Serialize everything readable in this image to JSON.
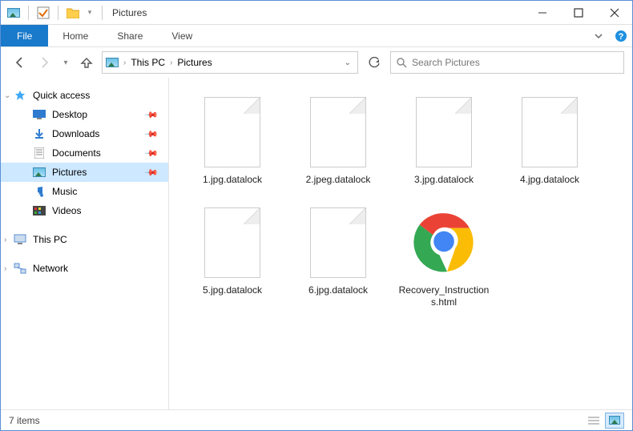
{
  "window": {
    "title": "Pictures"
  },
  "ribbon": {
    "file": "File",
    "tabs": [
      "Home",
      "Share",
      "View"
    ]
  },
  "breadcrumb": {
    "parts": [
      "This PC",
      "Pictures"
    ]
  },
  "search": {
    "placeholder": "Search Pictures"
  },
  "sidebar": {
    "quick_access": "Quick access",
    "quick_items": [
      {
        "label": "Desktop"
      },
      {
        "label": "Downloads"
      },
      {
        "label": "Documents"
      },
      {
        "label": "Pictures"
      },
      {
        "label": "Music"
      },
      {
        "label": "Videos"
      }
    ],
    "this_pc": "This PC",
    "network": "Network"
  },
  "files": [
    {
      "name": "1.jpg.datalock",
      "type": "file"
    },
    {
      "name": "2.jpeg.datalock",
      "type": "file"
    },
    {
      "name": "3.jpg.datalock",
      "type": "file"
    },
    {
      "name": "4.jpg.datalock",
      "type": "file"
    },
    {
      "name": "5.jpg.datalock",
      "type": "file"
    },
    {
      "name": "6.jpg.datalock",
      "type": "file"
    },
    {
      "name": "Recovery_Instructions.html",
      "type": "chrome"
    }
  ],
  "status": {
    "count_text": "7 items"
  }
}
